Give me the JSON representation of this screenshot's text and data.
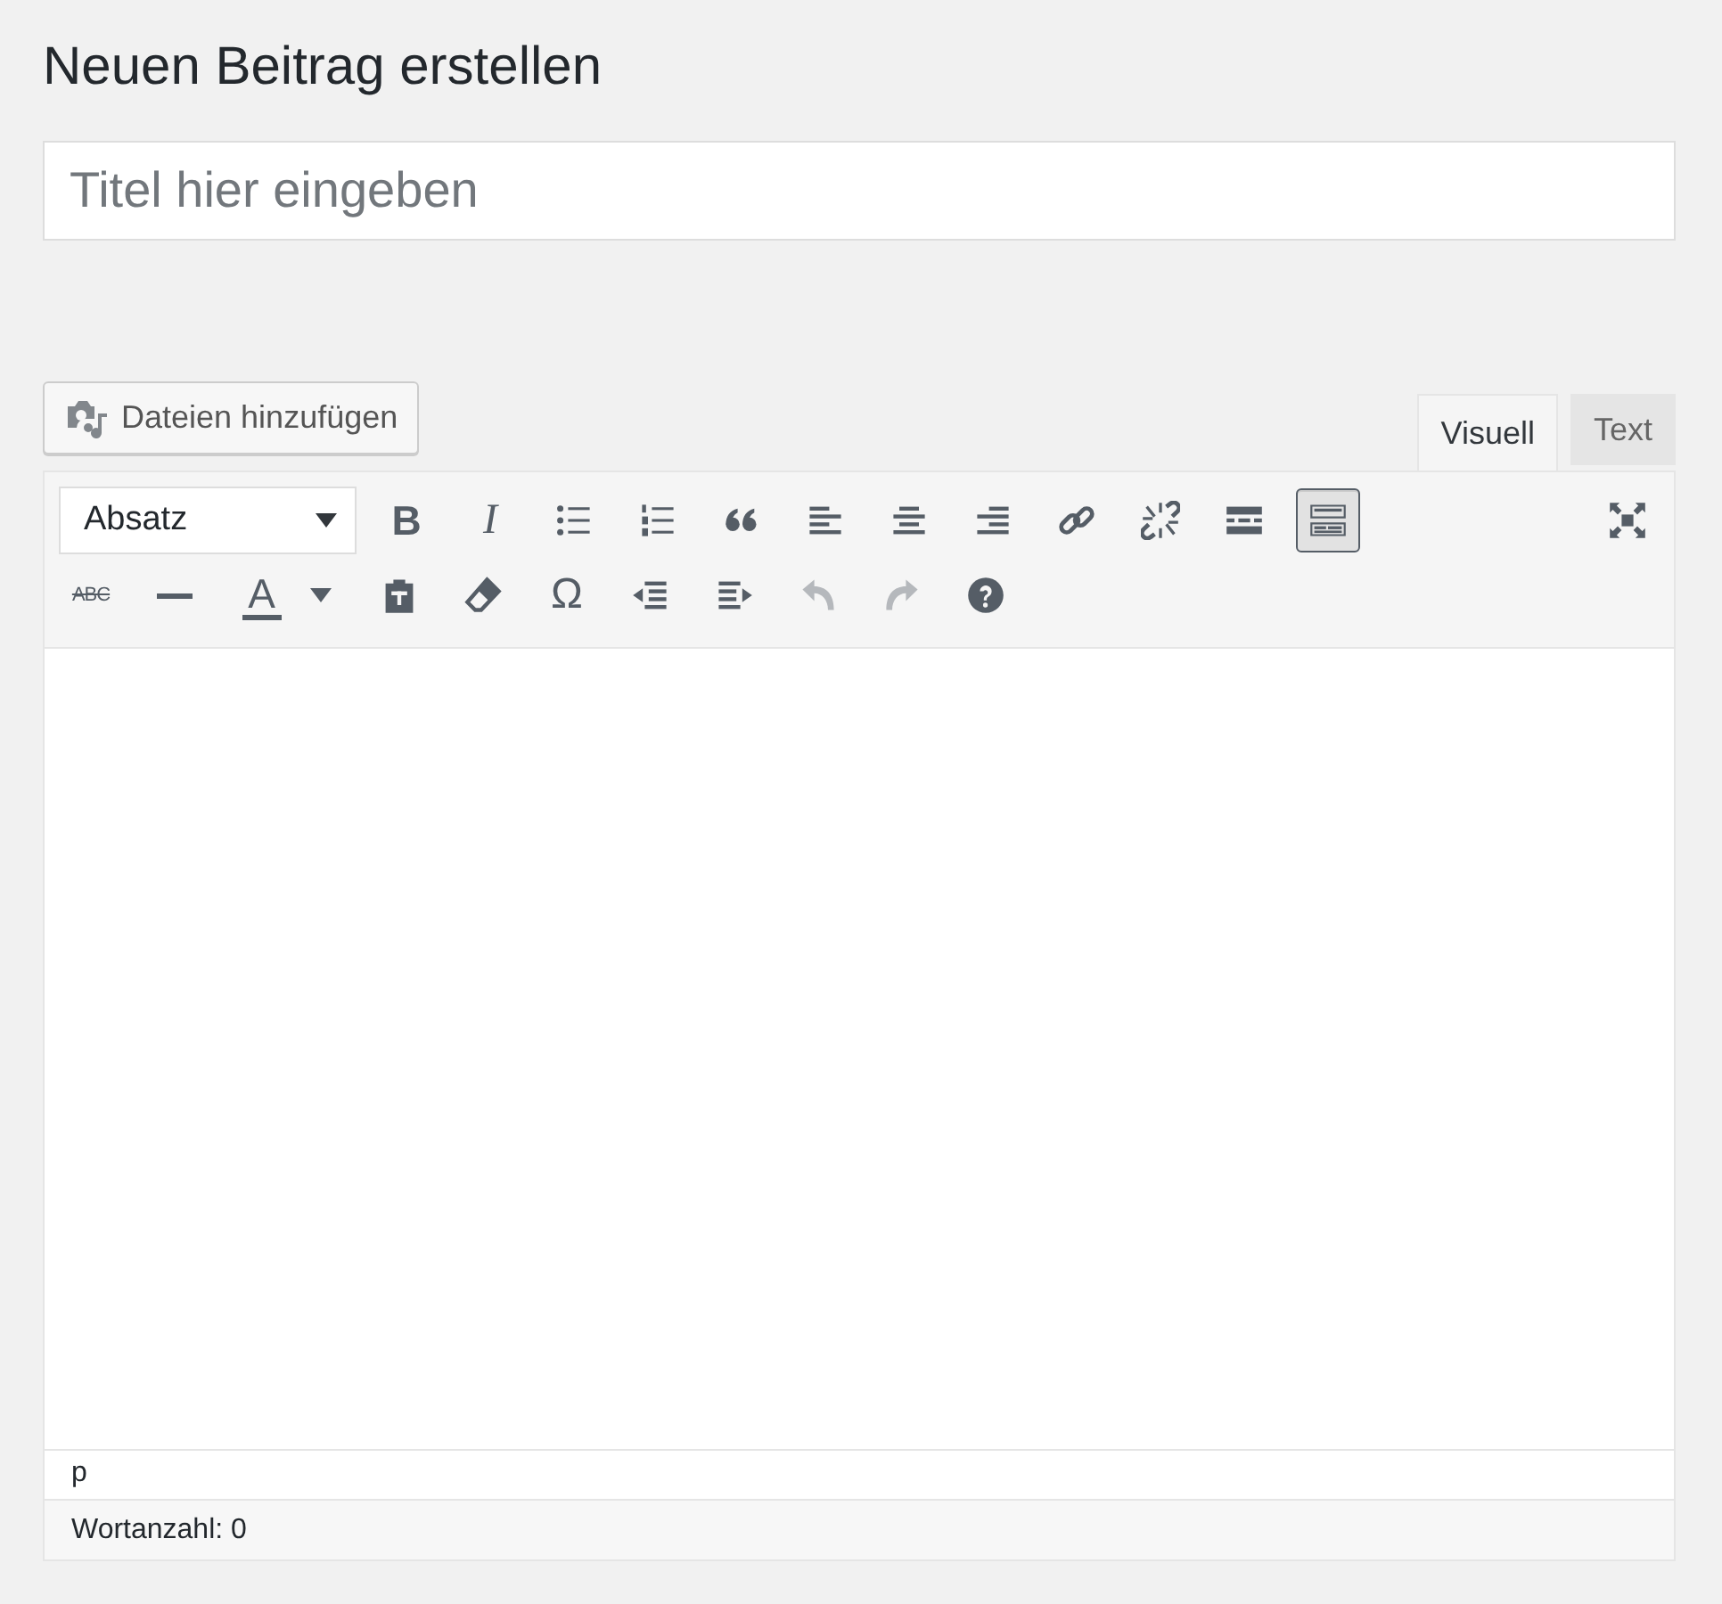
{
  "heading": "Neuen Beitrag erstellen",
  "title_field": {
    "placeholder": "Titel hier eingeben"
  },
  "media_button": {
    "label": "Dateien hinzufügen"
  },
  "tabs": [
    {
      "label": "Visuell",
      "selected": true
    },
    {
      "label": "Text",
      "selected": false
    }
  ],
  "toolbar_rows": [
    [
      {
        "kind": "format-select",
        "value": "Absatz",
        "active": false,
        "disabled": false
      },
      {
        "kind": "bold",
        "glyph": "B",
        "active": false,
        "disabled": false
      },
      {
        "kind": "italic",
        "glyph": "I",
        "active": false,
        "disabled": false
      },
      {
        "kind": "bullet-list",
        "active": false,
        "disabled": false
      },
      {
        "kind": "numbered-list",
        "active": false,
        "disabled": false
      },
      {
        "kind": "quote",
        "active": false,
        "disabled": false
      },
      {
        "kind": "align-left",
        "active": false,
        "disabled": false
      },
      {
        "kind": "align-center",
        "active": false,
        "disabled": false
      },
      {
        "kind": "align-right",
        "active": false,
        "disabled": false
      },
      {
        "kind": "link",
        "active": false,
        "disabled": false
      },
      {
        "kind": "unlink",
        "active": false,
        "disabled": false
      },
      {
        "kind": "more",
        "active": false,
        "disabled": false
      },
      {
        "kind": "toolbar-toggle",
        "active": true,
        "disabled": false
      },
      {
        "kind": "fullscreen",
        "active": false,
        "disabled": false
      }
    ],
    [
      {
        "kind": "strikethrough",
        "glyph": "ABC",
        "active": false,
        "disabled": false
      },
      {
        "kind": "horizontal-rule",
        "active": false,
        "disabled": false
      },
      {
        "kind": "text-color",
        "glyph": "A",
        "active": false,
        "disabled": false
      },
      {
        "kind": "paste-text",
        "active": false,
        "disabled": false
      },
      {
        "kind": "eraser",
        "active": false,
        "disabled": false
      },
      {
        "kind": "special-char",
        "glyph": "Ω",
        "active": false,
        "disabled": false
      },
      {
        "kind": "outdent",
        "active": false,
        "disabled": false
      },
      {
        "kind": "indent",
        "active": false,
        "disabled": false
      },
      {
        "kind": "undo",
        "active": false,
        "disabled": true
      },
      {
        "kind": "redo",
        "active": false,
        "disabled": true
      },
      {
        "kind": "help",
        "active": false,
        "disabled": false
      }
    ]
  ],
  "path_bar": "p",
  "word_count": "Wortanzahl: 0"
}
